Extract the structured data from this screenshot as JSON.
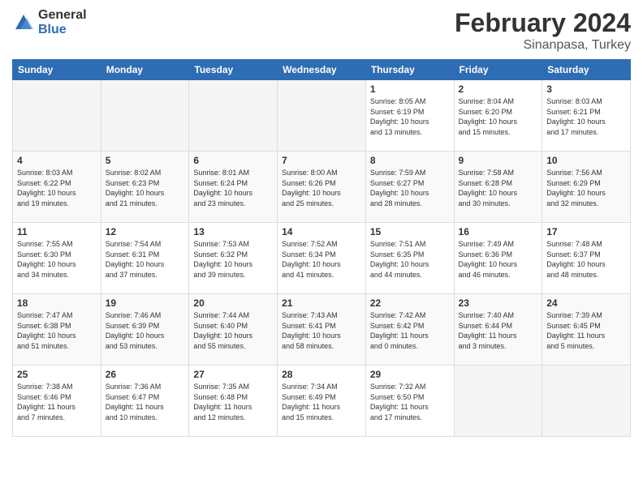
{
  "logo": {
    "general": "General",
    "blue": "Blue"
  },
  "header": {
    "title": "February 2024",
    "subtitle": "Sinanpasa, Turkey"
  },
  "days_of_week": [
    "Sunday",
    "Monday",
    "Tuesday",
    "Wednesday",
    "Thursday",
    "Friday",
    "Saturday"
  ],
  "weeks": [
    [
      {
        "day": "",
        "info": ""
      },
      {
        "day": "",
        "info": ""
      },
      {
        "day": "",
        "info": ""
      },
      {
        "day": "",
        "info": ""
      },
      {
        "day": "1",
        "info": "Sunrise: 8:05 AM\nSunset: 6:19 PM\nDaylight: 10 hours\nand 13 minutes."
      },
      {
        "day": "2",
        "info": "Sunrise: 8:04 AM\nSunset: 6:20 PM\nDaylight: 10 hours\nand 15 minutes."
      },
      {
        "day": "3",
        "info": "Sunrise: 8:03 AM\nSunset: 6:21 PM\nDaylight: 10 hours\nand 17 minutes."
      }
    ],
    [
      {
        "day": "4",
        "info": "Sunrise: 8:03 AM\nSunset: 6:22 PM\nDaylight: 10 hours\nand 19 minutes."
      },
      {
        "day": "5",
        "info": "Sunrise: 8:02 AM\nSunset: 6:23 PM\nDaylight: 10 hours\nand 21 minutes."
      },
      {
        "day": "6",
        "info": "Sunrise: 8:01 AM\nSunset: 6:24 PM\nDaylight: 10 hours\nand 23 minutes."
      },
      {
        "day": "7",
        "info": "Sunrise: 8:00 AM\nSunset: 6:26 PM\nDaylight: 10 hours\nand 25 minutes."
      },
      {
        "day": "8",
        "info": "Sunrise: 7:59 AM\nSunset: 6:27 PM\nDaylight: 10 hours\nand 28 minutes."
      },
      {
        "day": "9",
        "info": "Sunrise: 7:58 AM\nSunset: 6:28 PM\nDaylight: 10 hours\nand 30 minutes."
      },
      {
        "day": "10",
        "info": "Sunrise: 7:56 AM\nSunset: 6:29 PM\nDaylight: 10 hours\nand 32 minutes."
      }
    ],
    [
      {
        "day": "11",
        "info": "Sunrise: 7:55 AM\nSunset: 6:30 PM\nDaylight: 10 hours\nand 34 minutes."
      },
      {
        "day": "12",
        "info": "Sunrise: 7:54 AM\nSunset: 6:31 PM\nDaylight: 10 hours\nand 37 minutes."
      },
      {
        "day": "13",
        "info": "Sunrise: 7:53 AM\nSunset: 6:32 PM\nDaylight: 10 hours\nand 39 minutes."
      },
      {
        "day": "14",
        "info": "Sunrise: 7:52 AM\nSunset: 6:34 PM\nDaylight: 10 hours\nand 41 minutes."
      },
      {
        "day": "15",
        "info": "Sunrise: 7:51 AM\nSunset: 6:35 PM\nDaylight: 10 hours\nand 44 minutes."
      },
      {
        "day": "16",
        "info": "Sunrise: 7:49 AM\nSunset: 6:36 PM\nDaylight: 10 hours\nand 46 minutes."
      },
      {
        "day": "17",
        "info": "Sunrise: 7:48 AM\nSunset: 6:37 PM\nDaylight: 10 hours\nand 48 minutes."
      }
    ],
    [
      {
        "day": "18",
        "info": "Sunrise: 7:47 AM\nSunset: 6:38 PM\nDaylight: 10 hours\nand 51 minutes."
      },
      {
        "day": "19",
        "info": "Sunrise: 7:46 AM\nSunset: 6:39 PM\nDaylight: 10 hours\nand 53 minutes."
      },
      {
        "day": "20",
        "info": "Sunrise: 7:44 AM\nSunset: 6:40 PM\nDaylight: 10 hours\nand 55 minutes."
      },
      {
        "day": "21",
        "info": "Sunrise: 7:43 AM\nSunset: 6:41 PM\nDaylight: 10 hours\nand 58 minutes."
      },
      {
        "day": "22",
        "info": "Sunrise: 7:42 AM\nSunset: 6:42 PM\nDaylight: 11 hours\nand 0 minutes."
      },
      {
        "day": "23",
        "info": "Sunrise: 7:40 AM\nSunset: 6:44 PM\nDaylight: 11 hours\nand 3 minutes."
      },
      {
        "day": "24",
        "info": "Sunrise: 7:39 AM\nSunset: 6:45 PM\nDaylight: 11 hours\nand 5 minutes."
      }
    ],
    [
      {
        "day": "25",
        "info": "Sunrise: 7:38 AM\nSunset: 6:46 PM\nDaylight: 11 hours\nand 7 minutes."
      },
      {
        "day": "26",
        "info": "Sunrise: 7:36 AM\nSunset: 6:47 PM\nDaylight: 11 hours\nand 10 minutes."
      },
      {
        "day": "27",
        "info": "Sunrise: 7:35 AM\nSunset: 6:48 PM\nDaylight: 11 hours\nand 12 minutes."
      },
      {
        "day": "28",
        "info": "Sunrise: 7:34 AM\nSunset: 6:49 PM\nDaylight: 11 hours\nand 15 minutes."
      },
      {
        "day": "29",
        "info": "Sunrise: 7:32 AM\nSunset: 6:50 PM\nDaylight: 11 hours\nand 17 minutes."
      },
      {
        "day": "",
        "info": ""
      },
      {
        "day": "",
        "info": ""
      }
    ]
  ]
}
